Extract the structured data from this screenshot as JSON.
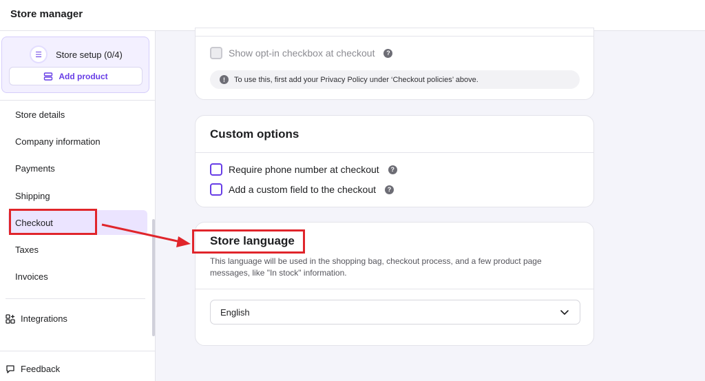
{
  "topbar": {
    "title": "Store manager"
  },
  "sidebar": {
    "setup": {
      "label": "Store setup (0/4)",
      "add_product_label": "Add product"
    },
    "items": [
      {
        "label": "Store details"
      },
      {
        "label": "Company information"
      },
      {
        "label": "Payments"
      },
      {
        "label": "Shipping"
      },
      {
        "label": "Checkout",
        "active": true
      },
      {
        "label": "Taxes"
      },
      {
        "label": "Invoices"
      }
    ],
    "integrations_label": "Integrations",
    "feedback_label": "Feedback"
  },
  "checkout_policies_card": {
    "opt_in_label": "Show opt-in checkbox at checkout",
    "info_text": "To use this, first add your Privacy Policy under ‘Checkout policies’ above."
  },
  "custom_options": {
    "title": "Custom options",
    "options": [
      {
        "label": "Require phone number at checkout"
      },
      {
        "label": "Add a custom field to the checkout"
      }
    ]
  },
  "store_language": {
    "title": "Store language",
    "description": "This language will be used in the shopping bag, checkout process, and a few product page messages, like \"In stock\" information.",
    "selected": "English"
  },
  "colors": {
    "accent": "#673de6",
    "annotation": "#e0252b"
  },
  "icons": [
    "list-icon",
    "product-icon",
    "help-icon",
    "info-icon",
    "chevron-down-icon",
    "integrations-icon",
    "feedback-icon"
  ]
}
